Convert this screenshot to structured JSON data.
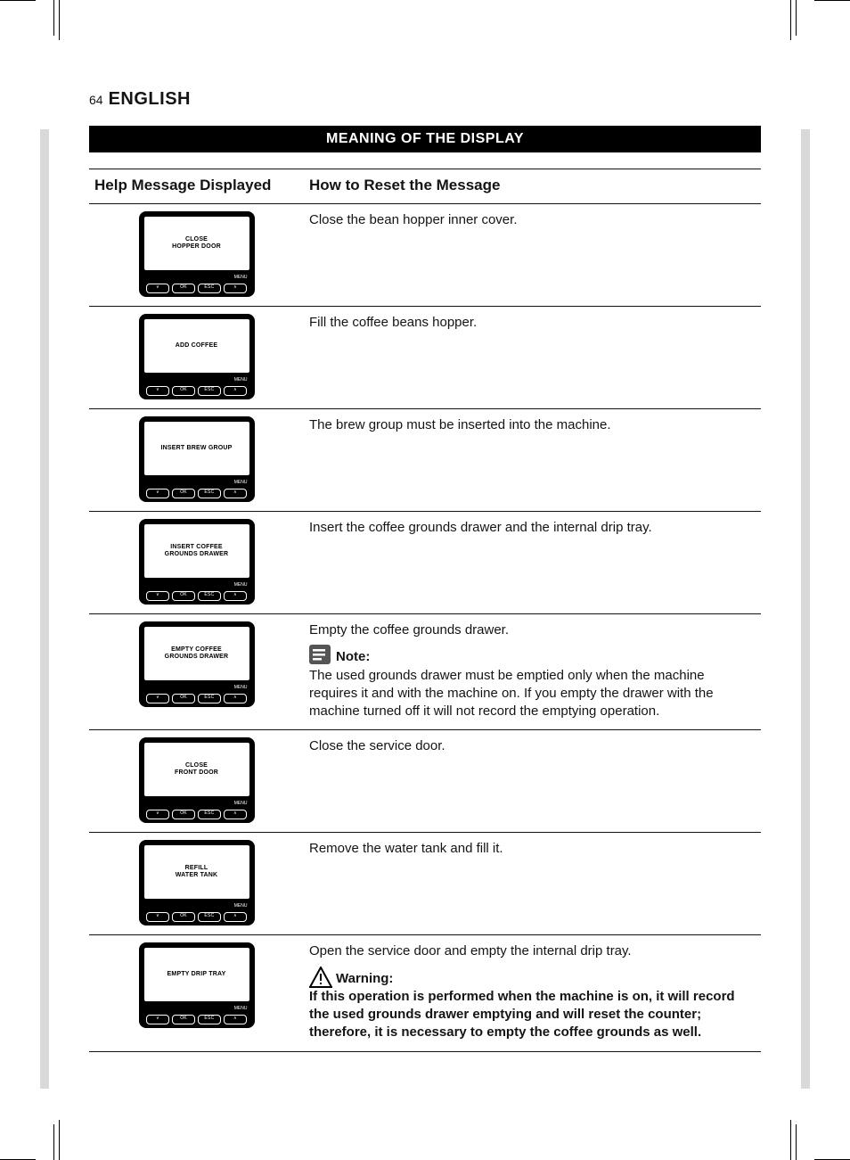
{
  "page_number": "64",
  "language_header": "ENGLISH",
  "section_title": "MEANING OF THE DISPLAY",
  "headers": {
    "help": "Help Message Displayed",
    "reset": "How to Reset the Message"
  },
  "lcd_btn_labels": {
    "left": "∨",
    "ok": "OK",
    "esc": "ESC",
    "right": "∧"
  },
  "lcd_top_labels": {
    "left": "",
    "right": "MENU"
  },
  "icons": {
    "note": "note-icon",
    "warning": "warning-icon"
  },
  "rows": [
    {
      "lcd_line1": "CLOSE",
      "lcd_line2": "HOPPER DOOR",
      "reset": "Close the bean hopper inner cover."
    },
    {
      "lcd_line1": "ADD COFFEE",
      "lcd_line2": "",
      "reset": "Fill the coffee beans hopper."
    },
    {
      "lcd_line1": "INSERT BREW GROUP",
      "lcd_line2": "",
      "reset": "The brew group must be inserted into the machine."
    },
    {
      "lcd_line1": "INSERT COFFEE",
      "lcd_line2": "GROUNDS DRAWER",
      "reset": "Insert the coffee grounds drawer and the internal drip tray."
    },
    {
      "lcd_line1": "EMPTY COFFEE",
      "lcd_line2": "GROUNDS DRAWER",
      "reset": "Empty the coffee grounds drawer.",
      "note_label": "Note:",
      "note_body": "The used grounds drawer must be emptied only when the machine requires it and with the machine on. If you empty the drawer with the machine turned off it will not record the emptying operation."
    },
    {
      "lcd_line1": "CLOSE",
      "lcd_line2": "FRONT DOOR",
      "reset": "Close the service door."
    },
    {
      "lcd_line1": "REFILL",
      "lcd_line2": "WATER TANK",
      "reset": "Remove the water tank and fill it."
    },
    {
      "lcd_line1": "EMPTY DRIP TRAY",
      "lcd_line2": "",
      "reset": "Open the service door and empty the internal drip tray.",
      "warn_label": "Warning:",
      "warn_body": "If this operation is performed when the machine is on, it will record the used grounds drawer emptying and will reset the counter; therefore, it is necessary to empty the coffee grounds as well."
    }
  ]
}
